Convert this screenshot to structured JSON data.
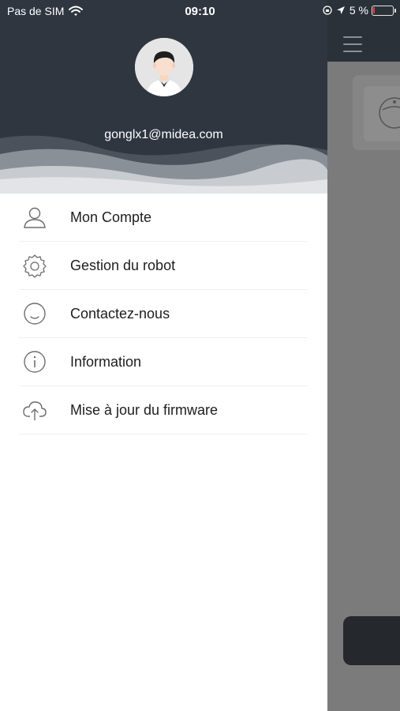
{
  "status_bar": {
    "carrier": "Pas de SIM",
    "time": "09:10",
    "battery": "5 %",
    "icons": [
      "wifi-icon",
      "orientation-lock-icon",
      "location-arrow-icon",
      "battery-icon"
    ]
  },
  "profile": {
    "email": "gonglx1@midea.com",
    "avatar": "avatar-icon"
  },
  "menu": {
    "items": [
      {
        "label": "Mon Compte",
        "icon": "user-icon"
      },
      {
        "label": "Gestion du robot",
        "icon": "gear-icon"
      },
      {
        "label": "Contactez-nous",
        "icon": "smile-icon"
      },
      {
        "label": "Information",
        "icon": "info-icon"
      },
      {
        "label": "Mise à jour du firmware",
        "icon": "cloud-upload-icon"
      }
    ]
  },
  "background_app": {
    "menu_icon": "hamburger-icon",
    "device_icon": "robot-vacuum-icon"
  },
  "colors": {
    "header_dark": "#2f3640",
    "overlay_gray": "#7b7b7b",
    "text": "#1d1d1d",
    "icon_stroke": "#6d6d6d"
  }
}
